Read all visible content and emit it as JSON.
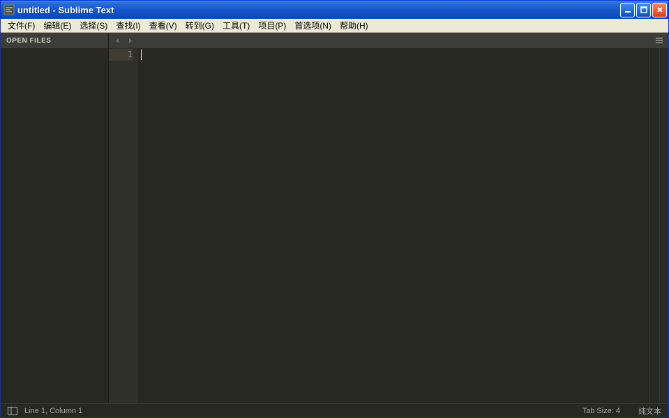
{
  "window": {
    "title": "untitled - Sublime Text"
  },
  "menu": {
    "file": "文件(F)",
    "edit": "编辑(E)",
    "select": "选择(S)",
    "find": "查找(I)",
    "view": "查看(V)",
    "goto": "转到(G)",
    "tools": "工具(T)",
    "project": "项目(P)",
    "prefs": "首选项(N)",
    "help": "帮助(H)"
  },
  "sidebar": {
    "header": "OPEN FILES"
  },
  "editor": {
    "line_number": "1"
  },
  "status": {
    "position": "Line 1, Column 1",
    "tab_size": "Tab Size: 4",
    "syntax": "纯文本"
  }
}
